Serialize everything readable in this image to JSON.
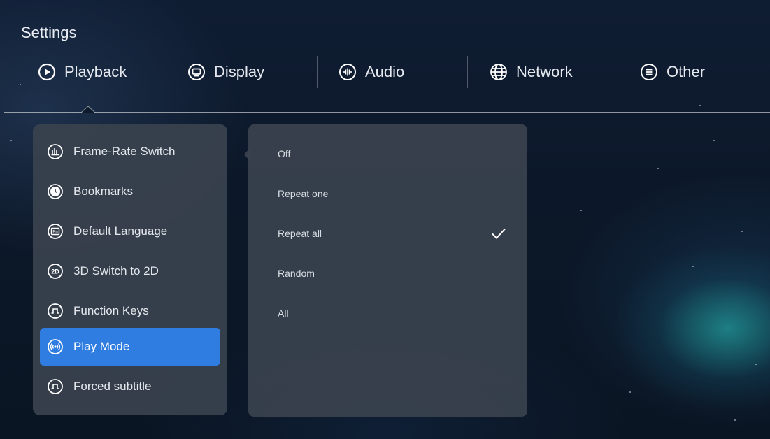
{
  "window": {
    "title": "Settings"
  },
  "tabs": [
    {
      "label": "Playback",
      "icon": "play-circle-icon",
      "selected": true
    },
    {
      "label": "Display",
      "icon": "monitor-icon"
    },
    {
      "label": "Audio",
      "icon": "audio-wave-icon"
    },
    {
      "label": "Network",
      "icon": "globe-icon"
    },
    {
      "label": "Other",
      "icon": "menu-circle-icon"
    }
  ],
  "playback_menu": {
    "items": [
      {
        "label": "Frame-Rate Switch",
        "icon": "frame-rate-icon"
      },
      {
        "label": "Bookmarks",
        "icon": "clock-icon"
      },
      {
        "label": "Default Language",
        "icon": "language-icon"
      },
      {
        "label": "3D Switch to 2D",
        "icon": "2d-icon"
      },
      {
        "label": "Function Keys",
        "icon": "function-key-icon"
      },
      {
        "label": "Play Mode",
        "icon": "broadcast-icon",
        "selected": true
      },
      {
        "label": "Forced subtitle",
        "icon": "function-key-icon"
      }
    ]
  },
  "play_mode_options": {
    "items": [
      {
        "label": "Off"
      },
      {
        "label": "Repeat one"
      },
      {
        "label": "Repeat all",
        "checked": true
      },
      {
        "label": "Random"
      },
      {
        "label": "All"
      }
    ]
  },
  "colors": {
    "accent": "#2f7de0",
    "panel": "#3a424e",
    "background": "#0c1829"
  }
}
